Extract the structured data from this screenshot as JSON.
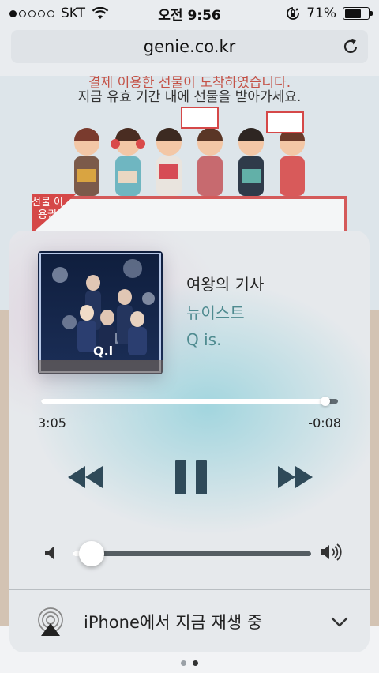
{
  "status_bar": {
    "carrier": "SKT",
    "time": "오전 9:56",
    "battery": "71%",
    "battery_level": 0.71
  },
  "browser": {
    "url": "genie.co.kr"
  },
  "webpage": {
    "promo_line1": "결제 이용한 선물이 도착하였습니다.",
    "promo_line2": "지금 유효 기간 내에 선물을 받아가세요.",
    "gift_tag": "선물 이용권"
  },
  "now_playing": {
    "title": "여왕의 기사",
    "artist": "뉴이스트",
    "album": "Q is.",
    "elapsed": "3:05",
    "remaining": "-0:08",
    "progress": 0.958,
    "volume": 0.08
  },
  "output": {
    "label": "iPhone에서 지금 재생 중"
  },
  "icons": {
    "play_state": "pause-icon",
    "output": "airplay-icon"
  }
}
